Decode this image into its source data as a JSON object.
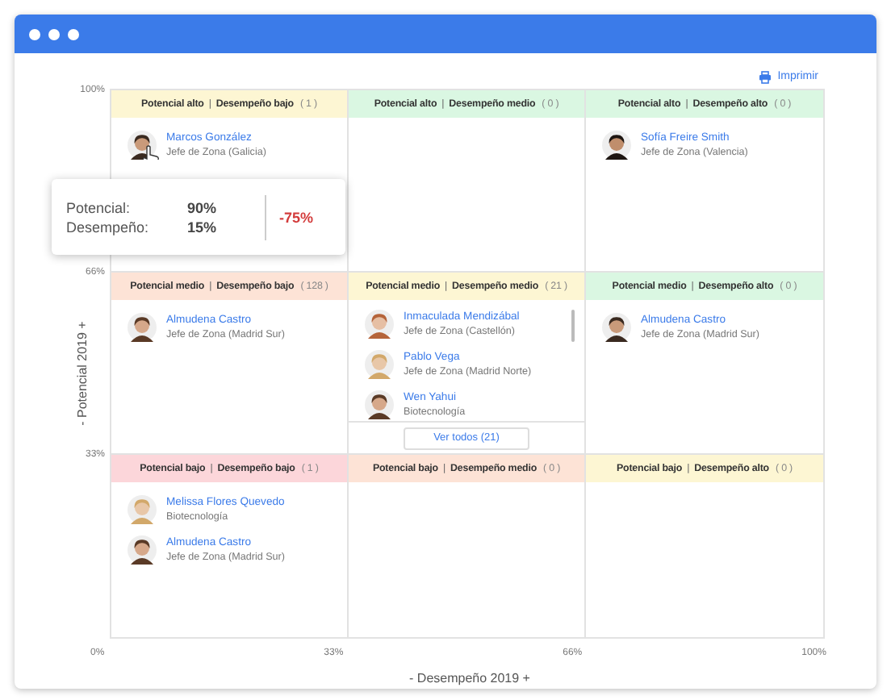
{
  "toolbar": {
    "print_label": "Imprimir"
  },
  "y_axis": {
    "title": "- Potencial 2019 +",
    "ticks": [
      "100%",
      "66%",
      "33%"
    ]
  },
  "grid": [
    [
      {
        "potential": "Potencial alto",
        "separator": "|",
        "performance": "Desempeño bajo",
        "count": "( 1 )",
        "color": "#fdf6d3",
        "people": [
          {
            "name": "Marcos González",
            "role": "Jefe de Zona (Galicia)",
            "hovered": true
          }
        ]
      },
      {
        "potential": "Potencial alto",
        "separator": "|",
        "performance": "Desempeño medio",
        "count": "( 0 )",
        "color": "#daf7e2"
      },
      {
        "potential": "Potencial alto",
        "separator": "|",
        "performance": "Desempeño alto",
        "count": "( 0 )",
        "color": "#daf7e2",
        "people": [
          {
            "name": "Sofía Freire Smith",
            "role": "Jefe de Zona (Valencia)",
            "hovered": false
          }
        ]
      }
    ],
    [
      {
        "potential": "Potencial medio",
        "separator": "|",
        "performance": "Desempeño bajo",
        "count": "( 128 )",
        "color": "#fde3d6",
        "people": [
          {
            "name": "Almudena Castro",
            "role": "Jefe de Zona (Madrid Sur)",
            "hovered": false
          }
        ]
      },
      {
        "potential": "Potencial medio",
        "separator": "|",
        "performance": "Desempeño medio",
        "count": "( 21 )",
        "color": "#fdf6d3",
        "scrollable": true,
        "more_button": "Ver todos (21)",
        "people": [
          {
            "name": "Inmaculada Mendizábal",
            "role": "Jefe de Zona (Castellón)",
            "hovered": false
          },
          {
            "name": "Pablo Vega",
            "role": "Jefe de Zona (Madrid Norte)",
            "hovered": false
          },
          {
            "name": "Wen Yahui",
            "role": "Biotecnología",
            "hovered": false
          }
        ]
      },
      {
        "potential": "Potencial medio",
        "separator": "|",
        "performance": "Desempeño alto",
        "count": "( 0 )",
        "color": "#daf7e2",
        "people": [
          {
            "name": "Almudena Castro",
            "role": "Jefe de Zona (Madrid Sur)",
            "hovered": false
          }
        ]
      }
    ],
    [
      {
        "potential": "Potencial bajo",
        "separator": "|",
        "performance": "Desempeño bajo",
        "count": "( 1 )",
        "color": "#fcd6da",
        "people": [
          {
            "name": "Melissa Flores Quevedo",
            "role": "Biotecnología",
            "hovered": false
          },
          {
            "name": "Almudena Castro",
            "role": "Jefe de Zona (Madrid Sur)",
            "hovered": false
          }
        ]
      },
      {
        "potential": "Potencial bajo",
        "separator": "|",
        "performance": "Desempeño medio",
        "count": "( 0 )",
        "color": "#fde3d6"
      },
      {
        "potential": "Potencial bajo",
        "separator": "|",
        "performance": "Desempeño alto",
        "count": "( 0 )",
        "color": "#fdf6d3"
      }
    ]
  ],
  "x_axis": {
    "ticks": [
      "0%",
      "33%",
      "66%",
      "100%"
    ],
    "title": "- Desempeño 2019 +"
  },
  "tooltip": {
    "rows": [
      {
        "label": "Potencial:",
        "value": "90%"
      },
      {
        "label": "Desempeño:",
        "value": "15%"
      }
    ],
    "delta": "-75%"
  }
}
